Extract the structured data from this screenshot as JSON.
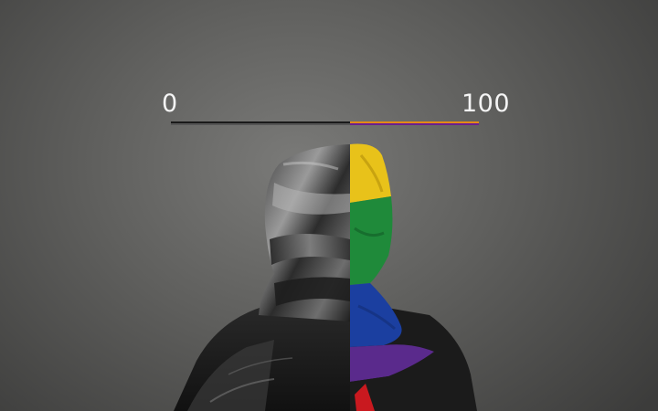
{
  "slider": {
    "min_label": "0",
    "max_label": "100",
    "value_fraction": 0.58
  },
  "colors": {
    "background": "#6b6b69",
    "slider_left": "#1a1a1a",
    "slider_right_top": "#e38a17",
    "slider_right_bottom": "#6a1f8f",
    "flag_yellow": "#e8c21a",
    "flag_green": "#1f8a3a",
    "flag_blue": "#1b3fa0",
    "flag_purple": "#5a2a8c",
    "flag_red": "#c9191f"
  },
  "image": {
    "subject": "hooded-figure-back-view"
  }
}
